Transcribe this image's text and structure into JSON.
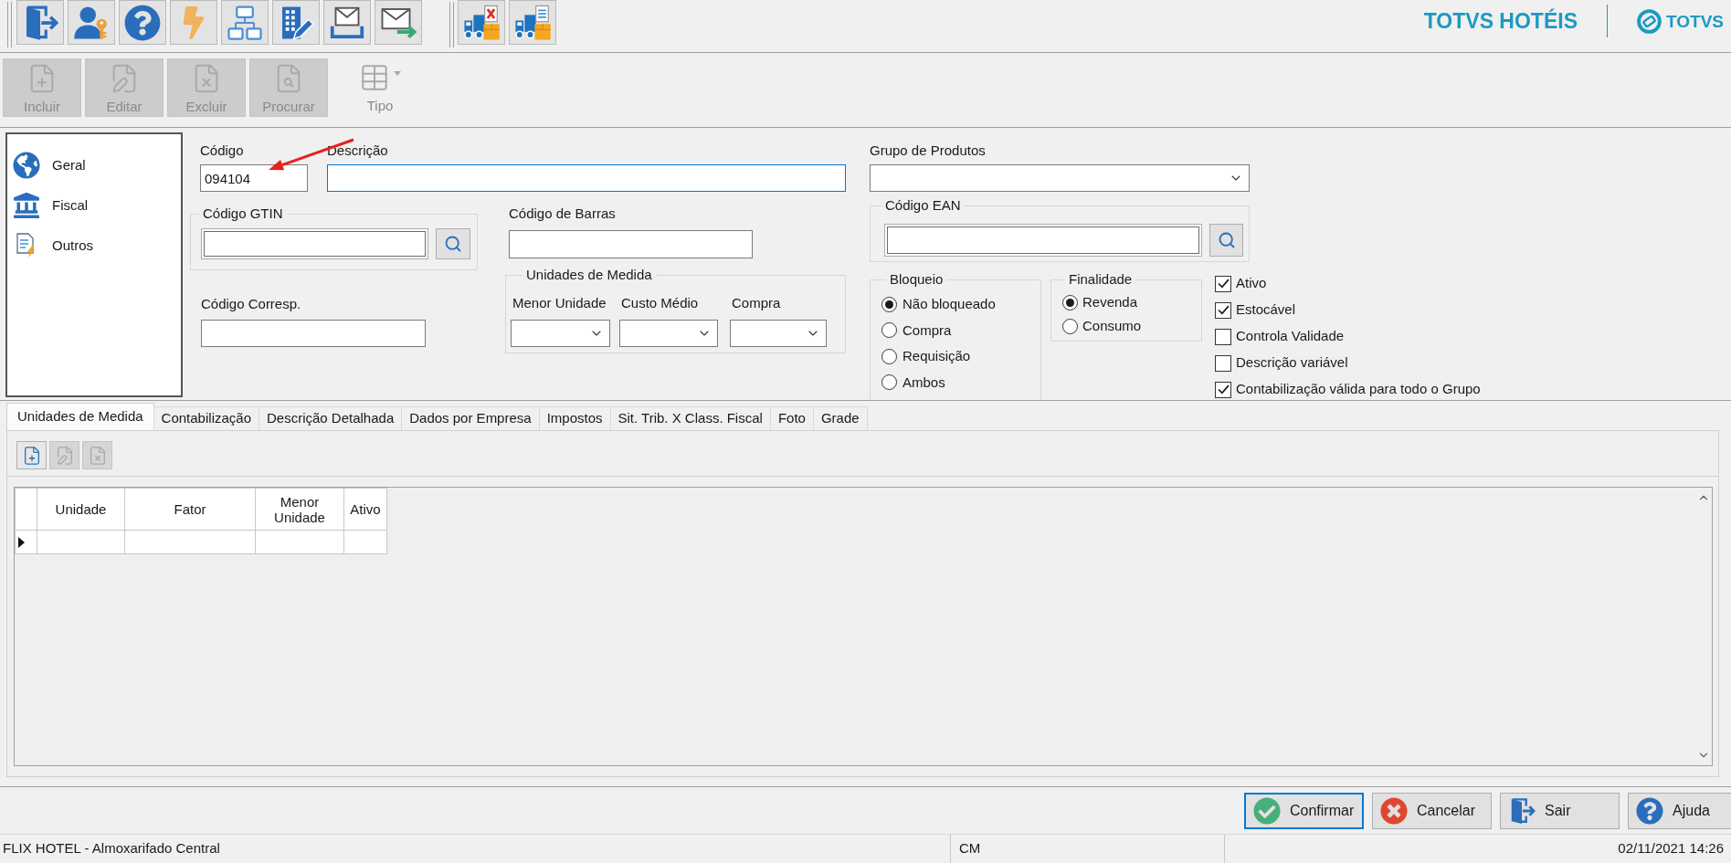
{
  "top_toolbar": {
    "brand": {
      "product": "TOTVS HOTÉIS",
      "company": "TOTVS"
    }
  },
  "action_toolbar": {
    "buttons": [
      {
        "label": "Incluir",
        "kind": "new",
        "disabled": true
      },
      {
        "label": "Editar",
        "kind": "edit",
        "disabled": true
      },
      {
        "label": "Excluir",
        "kind": "delete",
        "disabled": true
      },
      {
        "label": "Procurar",
        "kind": "search",
        "disabled": true
      },
      {
        "label": "Tipo",
        "kind": "dropdown",
        "disabled": true
      }
    ]
  },
  "sidebar": {
    "items": [
      {
        "label": "Geral",
        "kind": "general"
      },
      {
        "label": "Fiscal",
        "kind": "fiscal"
      },
      {
        "label": "Outros",
        "kind": "other"
      }
    ]
  },
  "form": {
    "codigo": {
      "label": "Código",
      "value": "094104",
      "focused": false
    },
    "descricao": {
      "label": "Descrição",
      "focused": true
    },
    "grupo_produtos": {
      "label": "Grupo de Produtos"
    },
    "codigo_gtin": {
      "legend": "Código GTIN"
    },
    "codigo_barras": {
      "label": "Código de Barras"
    },
    "codigo_corresp": {
      "label": "Código Corresp."
    },
    "unidades_medida": {
      "legend": "Unidades de Medida",
      "fields": [
        {
          "label": "Menor Unidade"
        },
        {
          "label": "Custo Médio"
        },
        {
          "label": "Compra"
        }
      ]
    },
    "codigo_ean": {
      "legend": "Código EAN"
    },
    "bloqueio": {
      "legend": "Bloqueio",
      "options": [
        {
          "label": "Não bloqueado",
          "selected": true
        },
        {
          "label": "Compra",
          "selected": false
        },
        {
          "label": "Requisição",
          "selected": false
        },
        {
          "label": "Ambos",
          "selected": false
        }
      ]
    },
    "finalidade": {
      "legend": "Finalidade",
      "options": [
        {
          "label": "Revenda",
          "selected": true
        },
        {
          "label": "Consumo",
          "selected": false
        }
      ]
    },
    "flags": [
      {
        "label": "Ativo",
        "checked": true
      },
      {
        "label": "Estocável",
        "checked": true
      },
      {
        "label": "Controla Validade",
        "checked": false
      },
      {
        "label": "Descrição variável",
        "checked": false
      },
      {
        "label": "Contabilização válida para todo o Grupo",
        "checked": true
      }
    ]
  },
  "tabs": [
    {
      "label": "Unidades de Medida",
      "selected": true
    },
    {
      "label": "Contabilização",
      "selected": false
    },
    {
      "label": "Descrição Detalhada",
      "selected": false
    },
    {
      "label": "Dados por Empresa",
      "selected": false
    },
    {
      "label": "Impostos",
      "selected": false
    },
    {
      "label": "Sit. Trib. X Class. Fiscal",
      "selected": false
    },
    {
      "label": "Foto",
      "selected": false
    },
    {
      "label": "Grade",
      "selected": false
    }
  ],
  "grid_toolbar": {
    "buttons": [
      {
        "kind": "new",
        "disabled": false
      },
      {
        "kind": "edit",
        "disabled": true
      },
      {
        "kind": "delete",
        "disabled": true
      }
    ]
  },
  "grid": {
    "columns": [
      "Unidade",
      "Fator",
      "Menor Unidade",
      "Ativo"
    ],
    "rows": [
      {
        "current": true
      }
    ]
  },
  "buttons": [
    {
      "label": "Confirmar",
      "kind": "confirm",
      "focused": true
    },
    {
      "label": "Cancelar",
      "kind": "cancel",
      "focused": false
    },
    {
      "label": "Sair",
      "kind": "exit",
      "focused": false
    },
    {
      "label": "Ajuda",
      "kind": "help",
      "focused": false
    }
  ],
  "status_bar": {
    "panels": [
      "FLIX HOTEL - Almoxarifado Central",
      "CM",
      "02/11/2021 14:26"
    ]
  }
}
